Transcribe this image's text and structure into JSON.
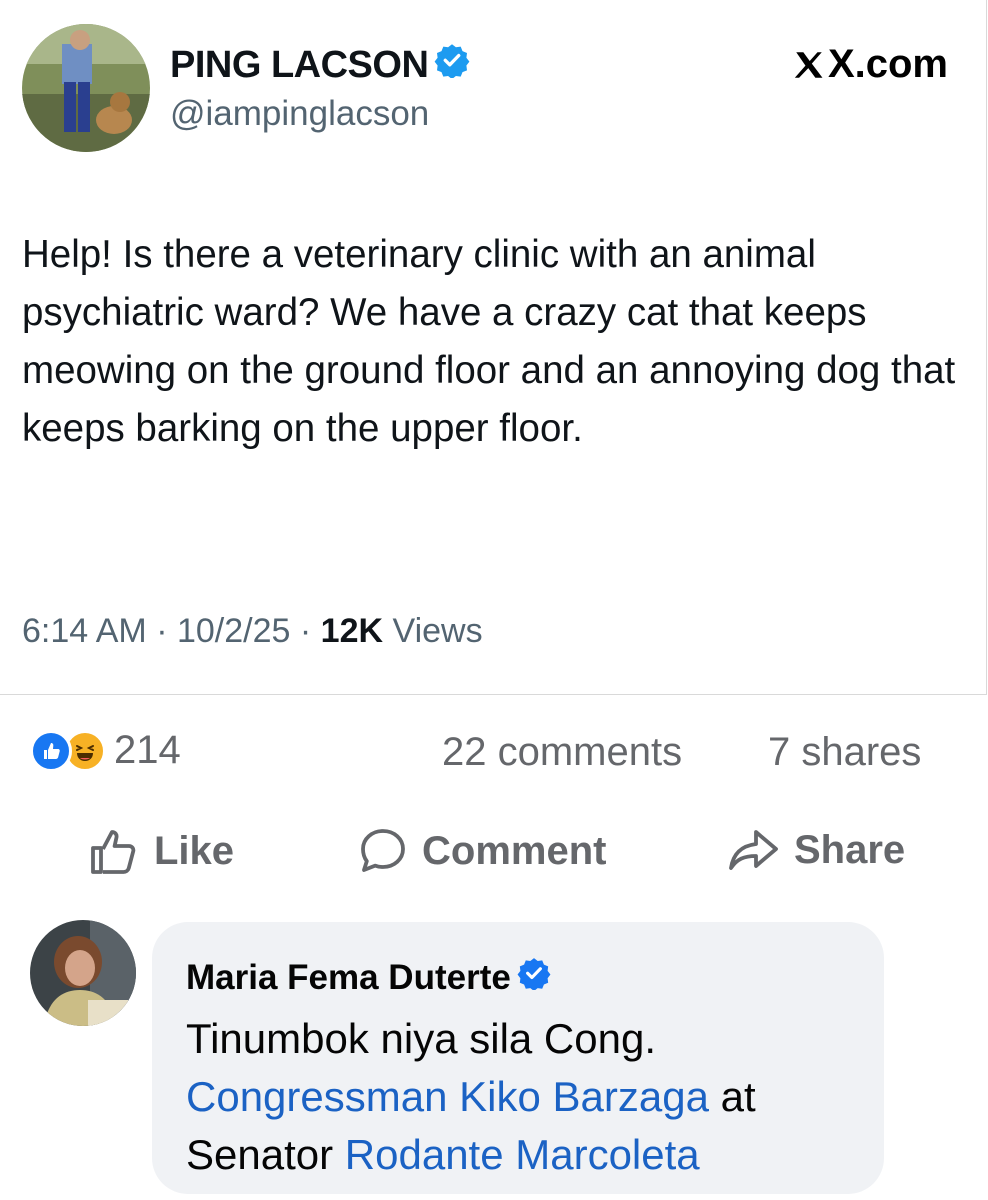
{
  "tweet": {
    "name": "PING LACSON",
    "handle": "@iampinglacson",
    "brand": "X.com",
    "text": "Help! Is there a veterinary clinic with an animal psychiatric ward? We have a crazy cat that keeps meowing on the ground floor and an annoying dog that keeps barking on the upper floor.",
    "time": "6:14 AM",
    "date": "10/2/25",
    "views_count": "12K",
    "views_label": "Views",
    "separator": "·"
  },
  "post_stats": {
    "reactions_count": "214",
    "comments": "22 comments",
    "shares": "7 shares",
    "reaction_icons": [
      "like-icon",
      "haha-icon"
    ]
  },
  "actions": {
    "like": "Like",
    "comment": "Comment",
    "share": "Share"
  },
  "comment": {
    "author": "Maria Fema Duterte",
    "text_part1": "Tinumbok niya sila Cong.",
    "mention1": "Congressman Kiko Barzaga",
    "text_part2": "at",
    "text_part3": "Senator",
    "mention2": "Rodante Marcoleta"
  },
  "colors": {
    "verified": "#1d9bf0",
    "facebook_blue": "#1877f2",
    "mention": "#1b62c4",
    "bubble": "#f0f2f5",
    "muted": "#65676b"
  }
}
